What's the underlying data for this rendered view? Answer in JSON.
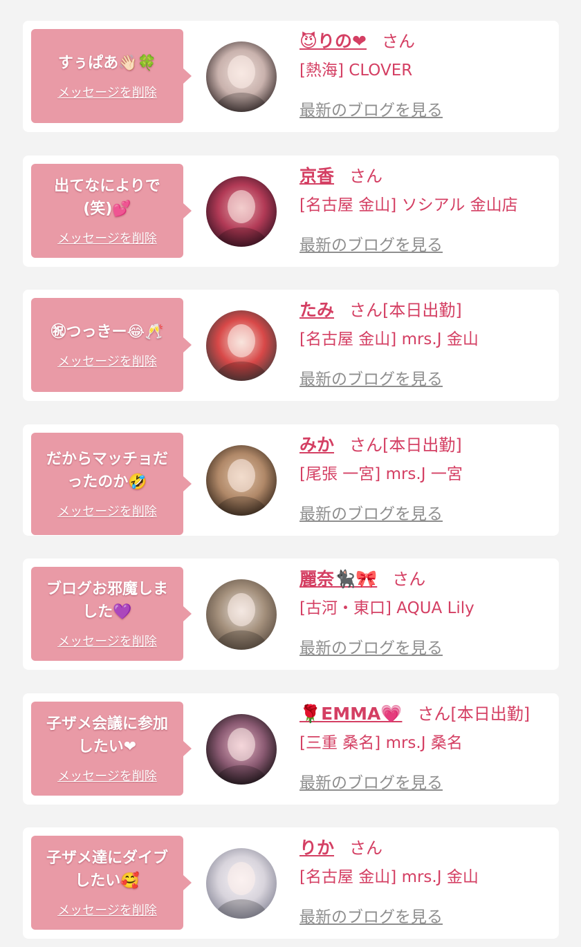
{
  "messages": [
    {
      "bubble": "すぅぱあ👋🏻🍀",
      "delete_label": "メッセージを削除",
      "name": "😈りの❤",
      "suffix": "さん",
      "shop": "[熱海] CLOVER",
      "blog_label": "最新のブログを見る",
      "avatar_colors": [
        "#3a2e2e",
        "#c9b2ad",
        "#efe0da"
      ]
    },
    {
      "bubble": "出てなによりで\n(笑)💕",
      "delete_label": "メッセージを削除",
      "name": "京香",
      "suffix": "さん",
      "shop": "[名古屋 金山] ソシアル 金山店",
      "blog_label": "最新のブログを見る",
      "avatar_colors": [
        "#3b1424",
        "#b23a56",
        "#e3a2a8"
      ]
    },
    {
      "bubble": "㊗つっきー😂🥂",
      "delete_label": "メッセージを削除",
      "name": "たみ",
      "suffix": "さん[本日出勤]",
      "shop": "[名古屋 金山] mrs.J 金山",
      "blog_label": "最新のブログを見る",
      "avatar_colors": [
        "#4b3d3d",
        "#d84848",
        "#f0d7cd"
      ]
    },
    {
      "bubble": "だからマッチョだ\nったのか🤣",
      "delete_label": "メッセージを削除",
      "name": "みか",
      "suffix": "さん[本日出勤]",
      "shop": "[尾張 一宮] mrs.J 一宮",
      "blog_label": "最新のブログを見る",
      "avatar_colors": [
        "#3a2a1e",
        "#b08868",
        "#e2c4a8"
      ]
    },
    {
      "bubble": "ブログお邪魔しま\nした💜",
      "delete_label": "メッセージを削除",
      "name": "麗奈🐈‍⬛🎀",
      "suffix": "さん",
      "shop": "[古河・東口] AQUA Lily",
      "blog_label": "最新のブログを見る",
      "avatar_colors": [
        "#5e5044",
        "#a4907c",
        "#e6ded8"
      ]
    },
    {
      "bubble": "子ザメ会議に参加\nしたい❤",
      "delete_label": "メッセージを削除",
      "name": "🌹EMMA💗",
      "suffix": "さん[本日出勤]",
      "shop": "[三重 桑名] mrs.J 桑名",
      "blog_label": "最新のブログを見る",
      "avatar_colors": [
        "#1c1418",
        "#8a5a72",
        "#e8b6c6"
      ]
    },
    {
      "bubble": "子ザメ達にダイブ\nしたい🥰",
      "delete_label": "メッセージを削除",
      "name": "りか",
      "suffix": "さん",
      "shop": "[名古屋 金山] mrs.J 金山",
      "blog_label": "最新のブログを見る",
      "avatar_colors": [
        "#8a8a9a",
        "#d8d4dc",
        "#f6f2f6"
      ]
    }
  ]
}
